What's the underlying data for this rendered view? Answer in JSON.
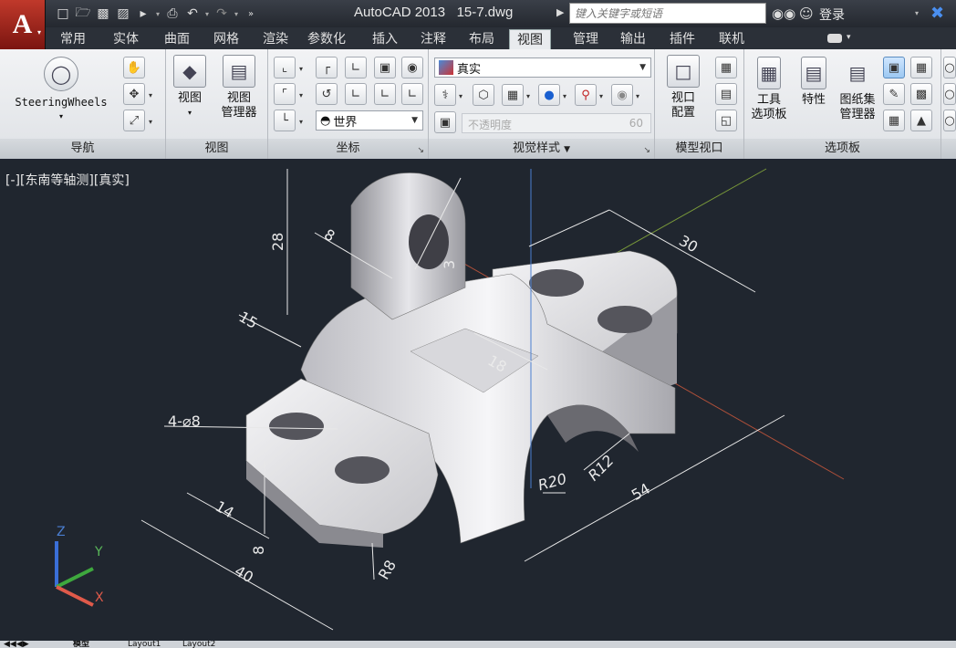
{
  "titlebar": {
    "app_title": "AutoCAD 2013",
    "file_name": "15-7.dwg",
    "search_placeholder": "键入关键字或短语",
    "login_label": "登录"
  },
  "tabs": [
    "常用",
    "实体",
    "曲面",
    "网格",
    "渲染",
    "参数化",
    "插入",
    "注释",
    "布局",
    "视图",
    "管理",
    "输出",
    "插件",
    "联机"
  ],
  "active_tab": "视图",
  "ribbon": {
    "navigation": {
      "title": "导航",
      "steering_label": "SteeringWheels"
    },
    "view": {
      "title": "视图",
      "view_label": "视图",
      "manager_line1": "视图",
      "manager_line2": "管理器"
    },
    "coordinates": {
      "title": "坐标",
      "ucs_value": "世界"
    },
    "visual_styles": {
      "title": "视觉样式",
      "style_value": "真实",
      "opacity_label": "不透明度",
      "opacity_value": "60"
    },
    "model_viewports": {
      "title": "模型视口",
      "config_line1": "视口",
      "config_line2": "配置"
    },
    "palettes": {
      "title": "选项板",
      "tool_line1": "工具",
      "tool_line2": "选项板",
      "properties_label": "特性",
      "sheetset_line1": "图纸集",
      "sheetset_line2": "管理器"
    }
  },
  "viewport": {
    "label": "[-][东南等轴测][真实]",
    "dimensions": {
      "d28": "28",
      "d8_top": "8",
      "d15": "15",
      "d3": "3",
      "d30": "30",
      "d18": "18",
      "hole_note": "4-⌀8",
      "d14": "14",
      "d8_bottom": "8",
      "d40": "40",
      "r8": "R8",
      "r20": "R20",
      "r12": "R12",
      "d54": "54"
    },
    "ucs": {
      "x": "X",
      "y": "Y",
      "z": "Z"
    }
  },
  "layout_tabs": [
    "模型",
    "Layout1",
    "Layout2"
  ]
}
